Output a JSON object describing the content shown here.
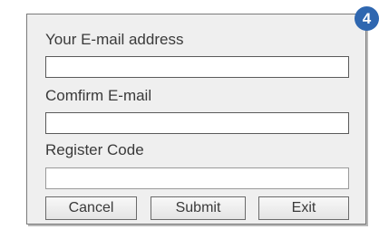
{
  "badge": {
    "step_number": "4",
    "color": "#2f67b0"
  },
  "form": {
    "email": {
      "label": "Your E-mail address",
      "value": ""
    },
    "confirm_email": {
      "label": "Comfirm E-mail",
      "value": ""
    },
    "register_code": {
      "label": "Register Code",
      "value": ""
    }
  },
  "buttons": {
    "cancel": "Cancel",
    "submit": "Submit",
    "exit": "Exit"
  }
}
